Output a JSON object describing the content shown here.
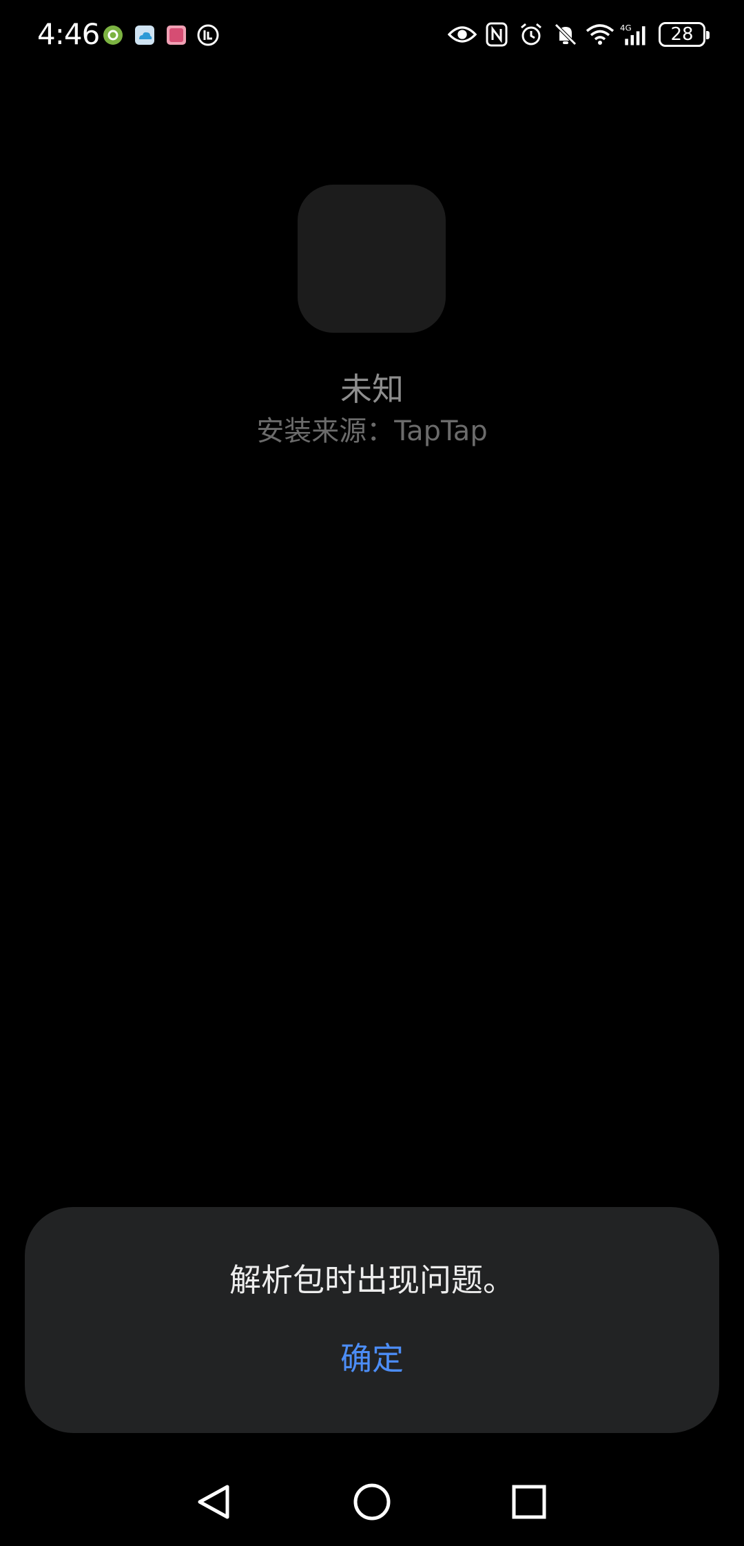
{
  "status_bar": {
    "time": "4:46",
    "notification_icons": [
      "settings-badge-icon",
      "cloud-icon",
      "photo-app-icon",
      "clock-badge-icon"
    ],
    "system_icons": [
      "eye-icon",
      "nfc-icon",
      "alarm-icon",
      "bell-off-icon",
      "wifi-icon",
      "signal-4g-icon"
    ],
    "network_label": "4G",
    "battery_level": "28"
  },
  "app": {
    "name": "未知",
    "install_source": "安装来源：TapTap"
  },
  "dialog": {
    "message": "解析包时出现问题。",
    "confirm_label": "确定",
    "accent_color": "#4c8df6"
  },
  "nav_bar": {
    "buttons": [
      "back-icon",
      "home-icon",
      "recents-icon"
    ]
  }
}
